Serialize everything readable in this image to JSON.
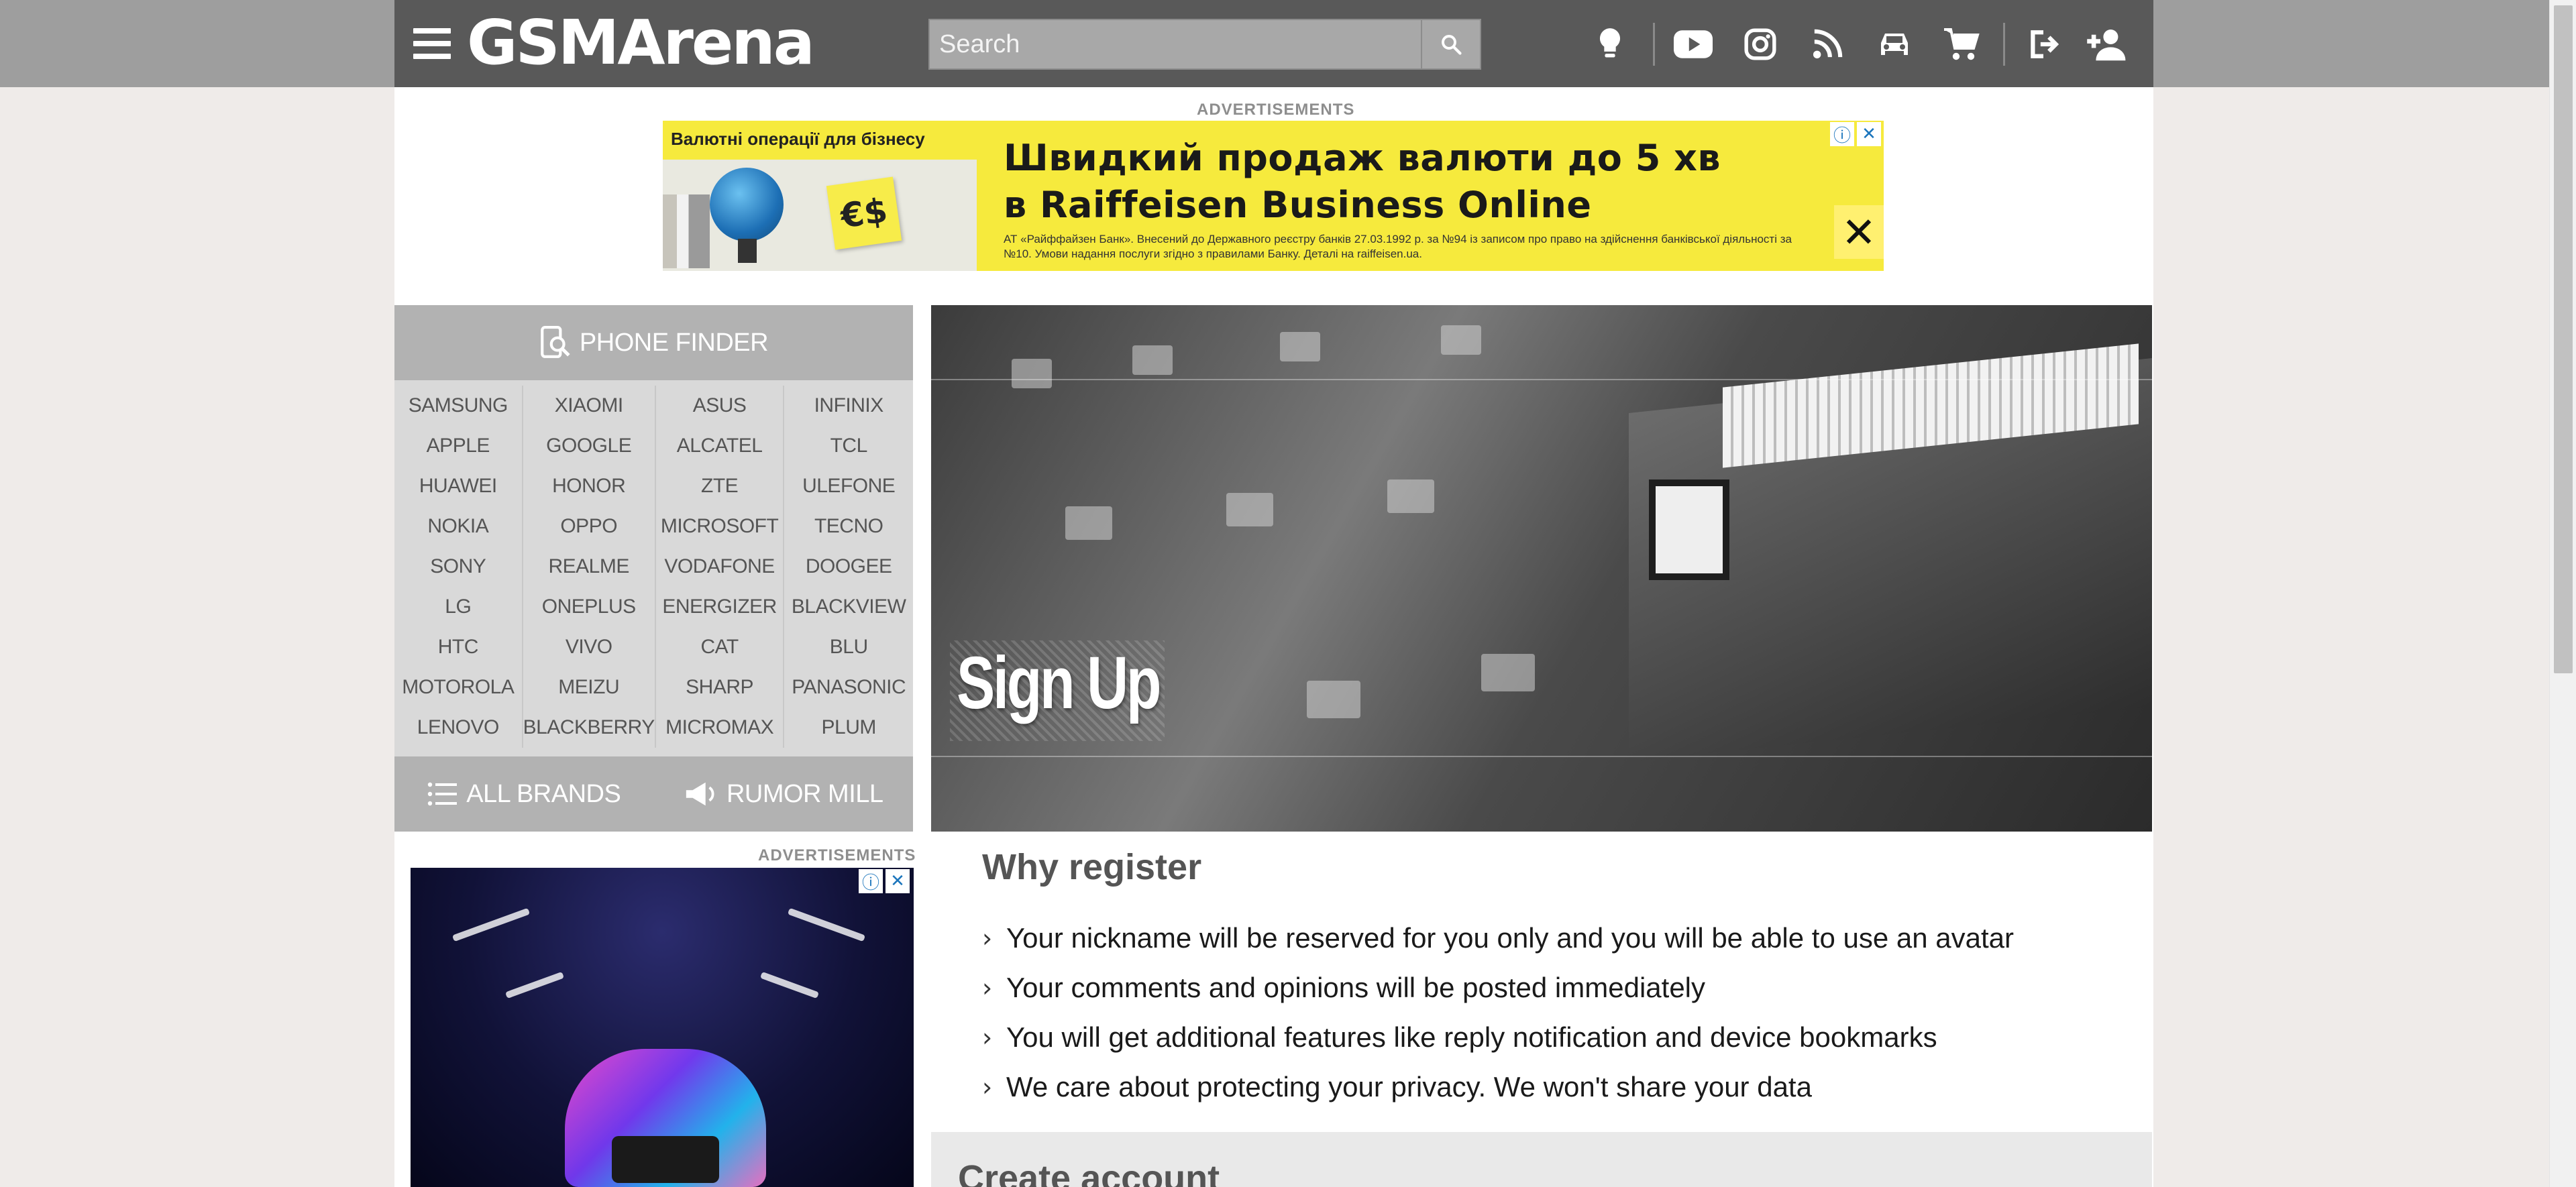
{
  "header": {
    "logo_text": "GSMArena",
    "search_placeholder": "Search",
    "icons": [
      "tip-us-icon",
      "youtube-icon",
      "instagram-icon",
      "rss-icon",
      "car-icon",
      "cart-icon",
      "login-icon",
      "signup-icon"
    ]
  },
  "ads": {
    "label": "ADVERTISEMENTS",
    "top": {
      "left_heading": "Валютні операції для бізнесу",
      "line1": "Швидкий продаж валюти до 5 хв",
      "line2": "в Raiffeisen Business Online",
      "fine_print": "АТ «Райффайзен Банк». Внесений до Державного реєстру банків 27.03.1992 р. за №94 із записом про право на здійснення банківської діяльності за №10. Умови надання послуги згідно з правилами Банку. Деталі на raiffeisen.ua.",
      "note_symbol": "€$"
    },
    "side_label": "ADVERTISEMENTS"
  },
  "sidebar": {
    "phone_finder": "PHONE FINDER",
    "brand_columns": [
      [
        "SAMSUNG",
        "APPLE",
        "HUAWEI",
        "NOKIA",
        "SONY",
        "LG",
        "HTC",
        "MOTOROLA",
        "LENOVO"
      ],
      [
        "XIAOMI",
        "GOOGLE",
        "HONOR",
        "OPPO",
        "REALME",
        "ONEPLUS",
        "VIVO",
        "MEIZU",
        "BLACKBERRY"
      ],
      [
        "ASUS",
        "ALCATEL",
        "ZTE",
        "MICROSOFT",
        "VODAFONE",
        "ENERGIZER",
        "CAT",
        "SHARP",
        "MICROMAX"
      ],
      [
        "INFINIX",
        "TCL",
        "ULEFONE",
        "TECNO",
        "DOOGEE",
        "BLACKVIEW",
        "BLU",
        "PANASONIC",
        "PLUM"
      ]
    ],
    "all_brands": "ALL BRANDS",
    "rumor_mill": "RUMOR MILL"
  },
  "hero": {
    "title": "Sign Up"
  },
  "why_register": {
    "title": "Why register",
    "items": [
      "Your nickname will be reserved for you only and you will be able to use an avatar",
      "Your comments and opinions will be posted immediately",
      "You will get additional features like reply notification and device bookmarks",
      "We care about protecting your privacy. We won't share your data"
    ]
  },
  "create_account": {
    "title": "Create account"
  }
}
